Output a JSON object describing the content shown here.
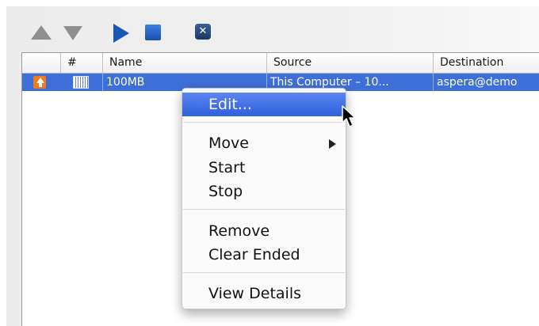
{
  "toolbar": {
    "move_up_icon": "triangle-up",
    "move_down_icon": "triangle-down",
    "start_icon": "play",
    "stop_icon": "stop-square",
    "clear_icon_glyph": "✕"
  },
  "table": {
    "columns": [
      "",
      "#",
      "Name",
      "Source",
      "Destination"
    ],
    "rows": [
      {
        "direction_icon": "upload-arrow",
        "index_icon": "progress-grid",
        "name": "100MB",
        "source": "This Computer – 10...",
        "destination": "aspera@demo"
      }
    ]
  },
  "context_menu": {
    "items": [
      "Edit...",
      "Move",
      "Start",
      "Stop",
      "Remove",
      "Clear Ended",
      "View Details"
    ],
    "highlighted": "Edit...",
    "submenu_item": "Move"
  },
  "colors": {
    "selection": "#3e6fd8",
    "menu_highlight": "#2f5fdb",
    "toolbar_blue": "#1a56b8",
    "upload_orange": "#f07a1e"
  }
}
